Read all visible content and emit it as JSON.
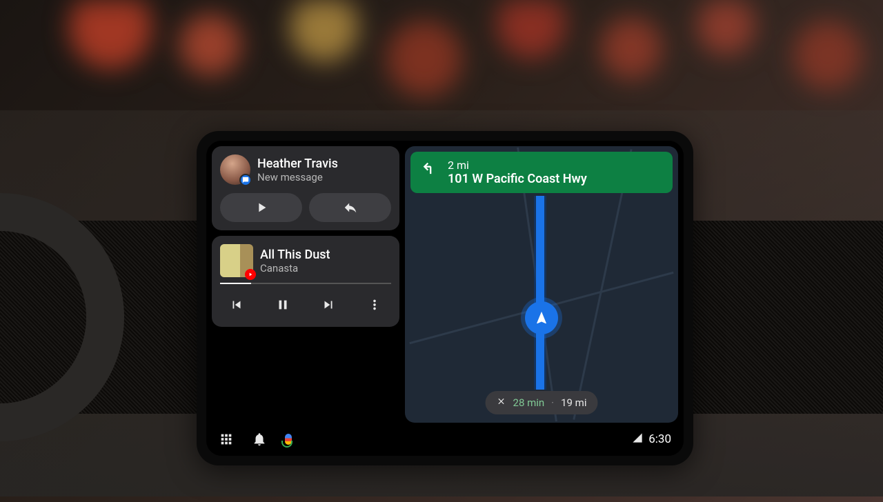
{
  "notification": {
    "sender": "Heather Travis",
    "subtitle": "New message"
  },
  "media": {
    "track": "All This Dust",
    "artist": "Canasta"
  },
  "navigation": {
    "distance": "2 mi",
    "road": "101 W Pacific Coast Hwy",
    "eta_time": "28 min",
    "eta_distance": "19 mi"
  },
  "status": {
    "time": "6:30"
  }
}
